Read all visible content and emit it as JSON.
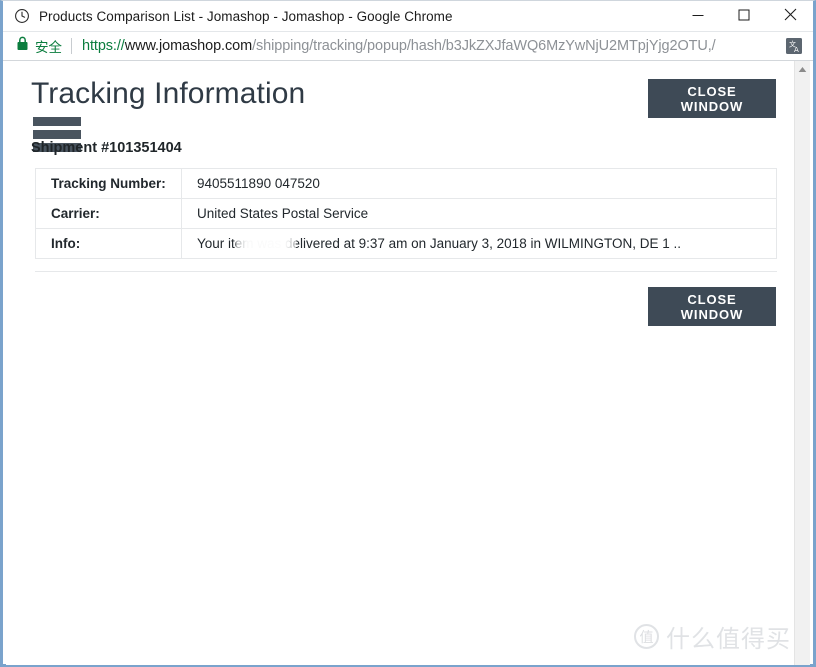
{
  "window": {
    "title": "Products Comparison List - Jomashop - Jomashop - Google Chrome",
    "favicon": "clock-icon",
    "controls": {
      "minimize": "minimize-icon",
      "maximize": "maximize-icon",
      "close": "close-icon"
    }
  },
  "addressbar": {
    "lock_icon": "lock-icon",
    "secure_label": "安全",
    "url_scheme": "https://",
    "url_host": "www.jomashop.com",
    "url_path": "/shipping/tracking/popup/hash/b3JkZXJfaWQ6MzYwNjU2MTpjYjg2OTU,/",
    "url_full": "https://www.jomashop.com/shipping/tracking/popup/hash/b3JkZXJfaWQ6MzYwNjU2MTpjYjg2OTU,/",
    "translate_icon": "translate-icon"
  },
  "page": {
    "title": "Tracking Information",
    "shipment_id": "Shipment #101351404",
    "close_button_top": "CLOSE WINDOW",
    "close_button_bottom": "CLOSE WINDOW",
    "table": [
      {
        "label": "Tracking Number:",
        "value": "9405511890          047520"
      },
      {
        "label": "Carrier:",
        "value": "United States Postal Service"
      },
      {
        "label": "Info:",
        "value": "Your item was delivered at 9:37 am on January 3, 2018 in WILMINGTON, DE 1     .."
      }
    ]
  },
  "scrollbar": {
    "up_arrow": "chevron-up-icon"
  },
  "watermark": {
    "mark": "值",
    "text": "什么值得买"
  },
  "colors": {
    "button_bg": "#3e4a56",
    "secure_green": "#0b7d3e",
    "redaction": "#49545f",
    "window_border": "#7aa3cc"
  }
}
